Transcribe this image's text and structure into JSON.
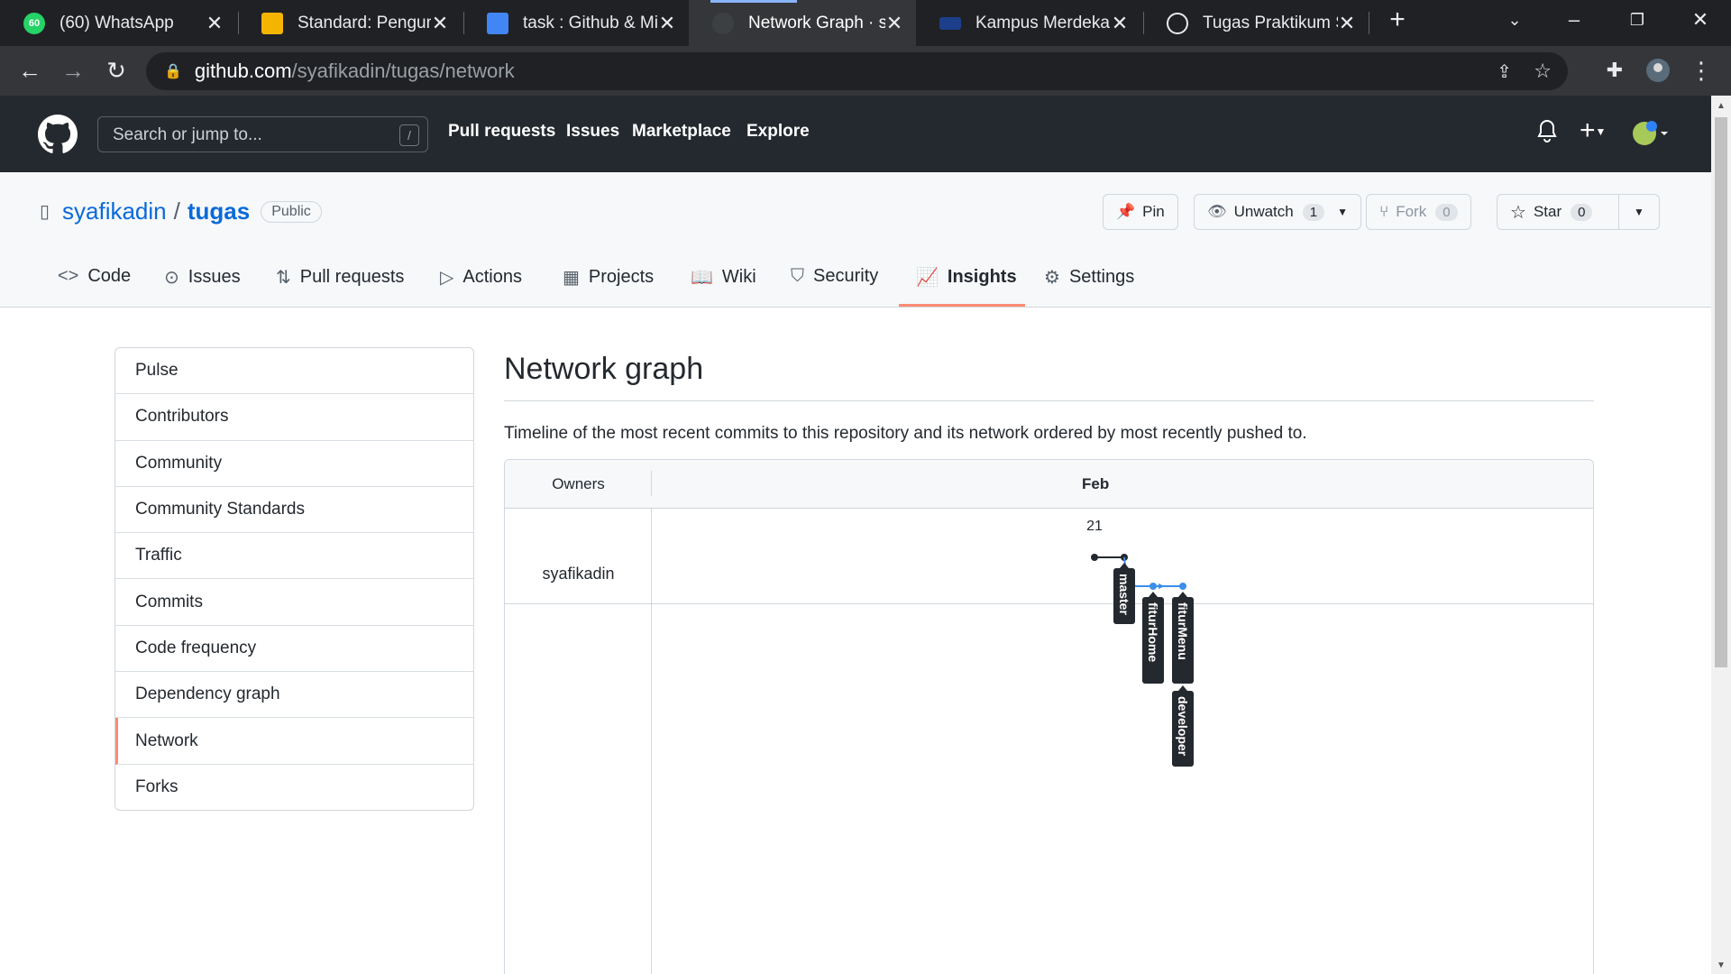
{
  "browser": {
    "tabs": [
      {
        "title": "(60) WhatsApp",
        "icon": "whatsapp-icon",
        "badge": "60"
      },
      {
        "title": "Standard: Pengump",
        "icon": "slides-icon"
      },
      {
        "title": "task : Github & Mir",
        "icon": "docs-icon"
      },
      {
        "title": "Network Graph · sy",
        "icon": "github-icon"
      },
      {
        "title": "Kampus Merdeka",
        "icon": "kampus-merdeka-icon"
      },
      {
        "title": "Tugas Praktikum Se",
        "icon": "globe-icon"
      }
    ],
    "url_host": "github.com",
    "url_path": "/syafikadin/tugas/network"
  },
  "gh": {
    "search_placeholder": "Search or jump to...",
    "search_key": "/",
    "nav": [
      "Pull requests",
      "Issues",
      "Marketplace",
      "Explore"
    ]
  },
  "repo": {
    "owner": "syafikadin",
    "name": "tugas",
    "visibility": "Public",
    "pin": "Pin",
    "unwatch": "Unwatch",
    "watch_count": "1",
    "fork": "Fork",
    "fork_count": "0",
    "star": "Star",
    "star_count": "0",
    "tabs": [
      "Code",
      "Issues",
      "Pull requests",
      "Actions",
      "Projects",
      "Wiki",
      "Security",
      "Insights",
      "Settings"
    ]
  },
  "sidebar": {
    "items": [
      "Pulse",
      "Contributors",
      "Community",
      "Community Standards",
      "Traffic",
      "Commits",
      "Code frequency",
      "Dependency graph",
      "Network",
      "Forks"
    ],
    "selected": "Network"
  },
  "main": {
    "title": "Network graph",
    "description": "Timeline of the most recent commits to this repository and its network ordered by most recently pushed to.",
    "owners_header": "Owners",
    "month": "Feb",
    "day": "21",
    "owner": "syafikadin",
    "branches": [
      "master",
      "fiturHome",
      "fiturMenu",
      "developer"
    ]
  },
  "colors": {
    "accent_underline": "#fd8c73",
    "link": "#0969da",
    "branch_blue": "#3b8eea",
    "header_bg": "#24292f"
  }
}
